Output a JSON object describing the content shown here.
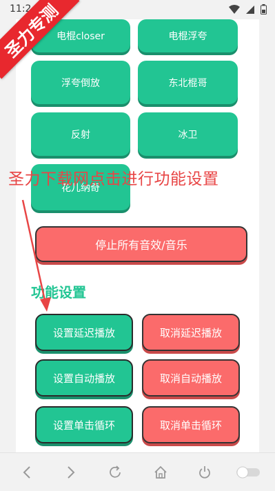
{
  "status": {
    "time": "11:2"
  },
  "ribbon": {
    "text": "圣力专测"
  },
  "grid_buttons": [
    {
      "label": "电棍closer"
    },
    {
      "label": "电棍浮夸"
    },
    {
      "label": "浮夸倒放"
    },
    {
      "label": "东北棍哥"
    },
    {
      "label": "反射"
    },
    {
      "label": "冰卫"
    },
    {
      "label": "花儿纳奇"
    }
  ],
  "overlay": {
    "text": "圣力下载网点击进行功能设置"
  },
  "stop_all": {
    "label": "停止所有音效/音乐"
  },
  "settings": {
    "title": "功能设置",
    "set_delay": "设置延迟播放",
    "cancel_delay": "取消延迟播放",
    "set_auto": "设置自动播放",
    "cancel_auto": "取消自动播放",
    "set_loop": "设置单击循环",
    "cancel_loop": "取消单击循环"
  },
  "colors": {
    "green": "#22c593",
    "red": "#fb6b6b",
    "annotation": "#e84545"
  },
  "nav_icons": [
    "back-icon",
    "forward-icon",
    "refresh-icon",
    "home-icon",
    "power-icon",
    "toggle-icon"
  ]
}
